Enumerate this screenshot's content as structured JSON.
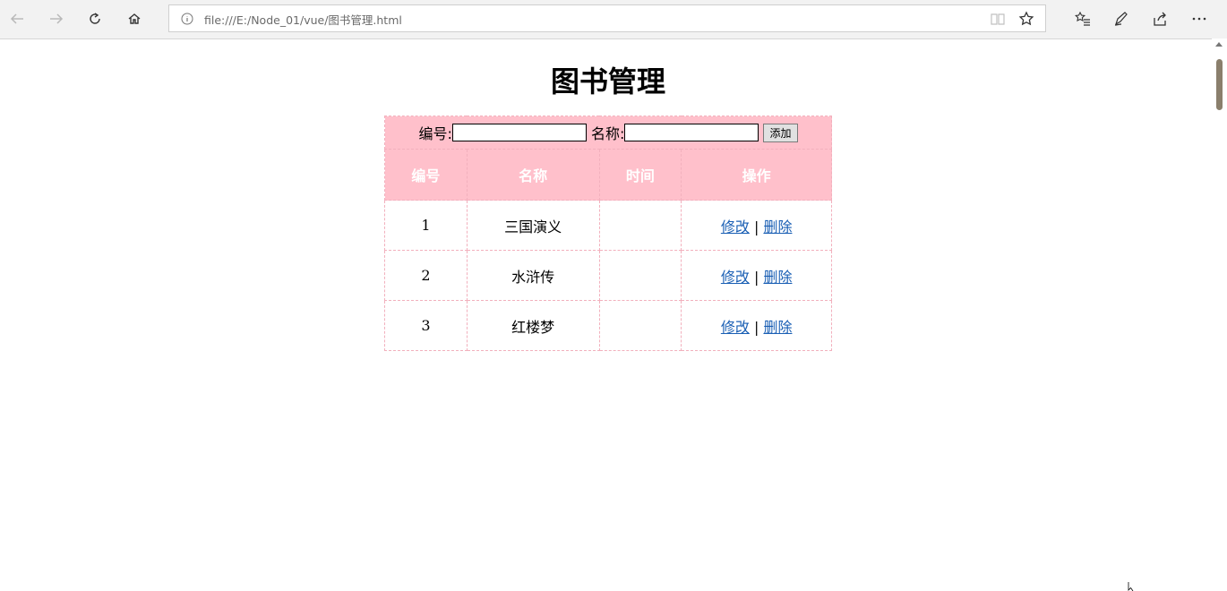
{
  "browser": {
    "url": "file:///E:/Node_01/vue/图书管理.html",
    "nav": {
      "back_icon": "back-arrow-icon",
      "forward_icon": "forward-arrow-icon",
      "refresh_icon": "refresh-icon",
      "home_icon": "home-icon"
    },
    "toolbar_icons": [
      "reading-view-icon",
      "favorite-star-icon",
      "favorites-list-icon",
      "pen-notes-icon",
      "share-icon",
      "more-dots-icon"
    ]
  },
  "page": {
    "title": "图书管理",
    "form": {
      "id_label": "编号:",
      "id_value": "",
      "name_label": "名称:",
      "name_value": "",
      "add_button": "添加"
    },
    "table": {
      "headers": [
        "编号",
        "名称",
        "时间",
        "操作"
      ],
      "rows": [
        {
          "id": "1",
          "name": "三国演义",
          "time": "",
          "edit": "修改",
          "sep": "|",
          "delete": "删除"
        },
        {
          "id": "2",
          "name": "水浒传",
          "time": "",
          "edit": "修改",
          "sep": "|",
          "delete": "删除"
        },
        {
          "id": "3",
          "name": "红楼梦",
          "time": "",
          "edit": "修改",
          "sep": "|",
          "delete": "删除"
        }
      ]
    }
  },
  "colors": {
    "header_bg": "#ffc0cb",
    "header_text": "#ffffff",
    "link": "#1a5fb4",
    "border": "#f2b0bd"
  }
}
